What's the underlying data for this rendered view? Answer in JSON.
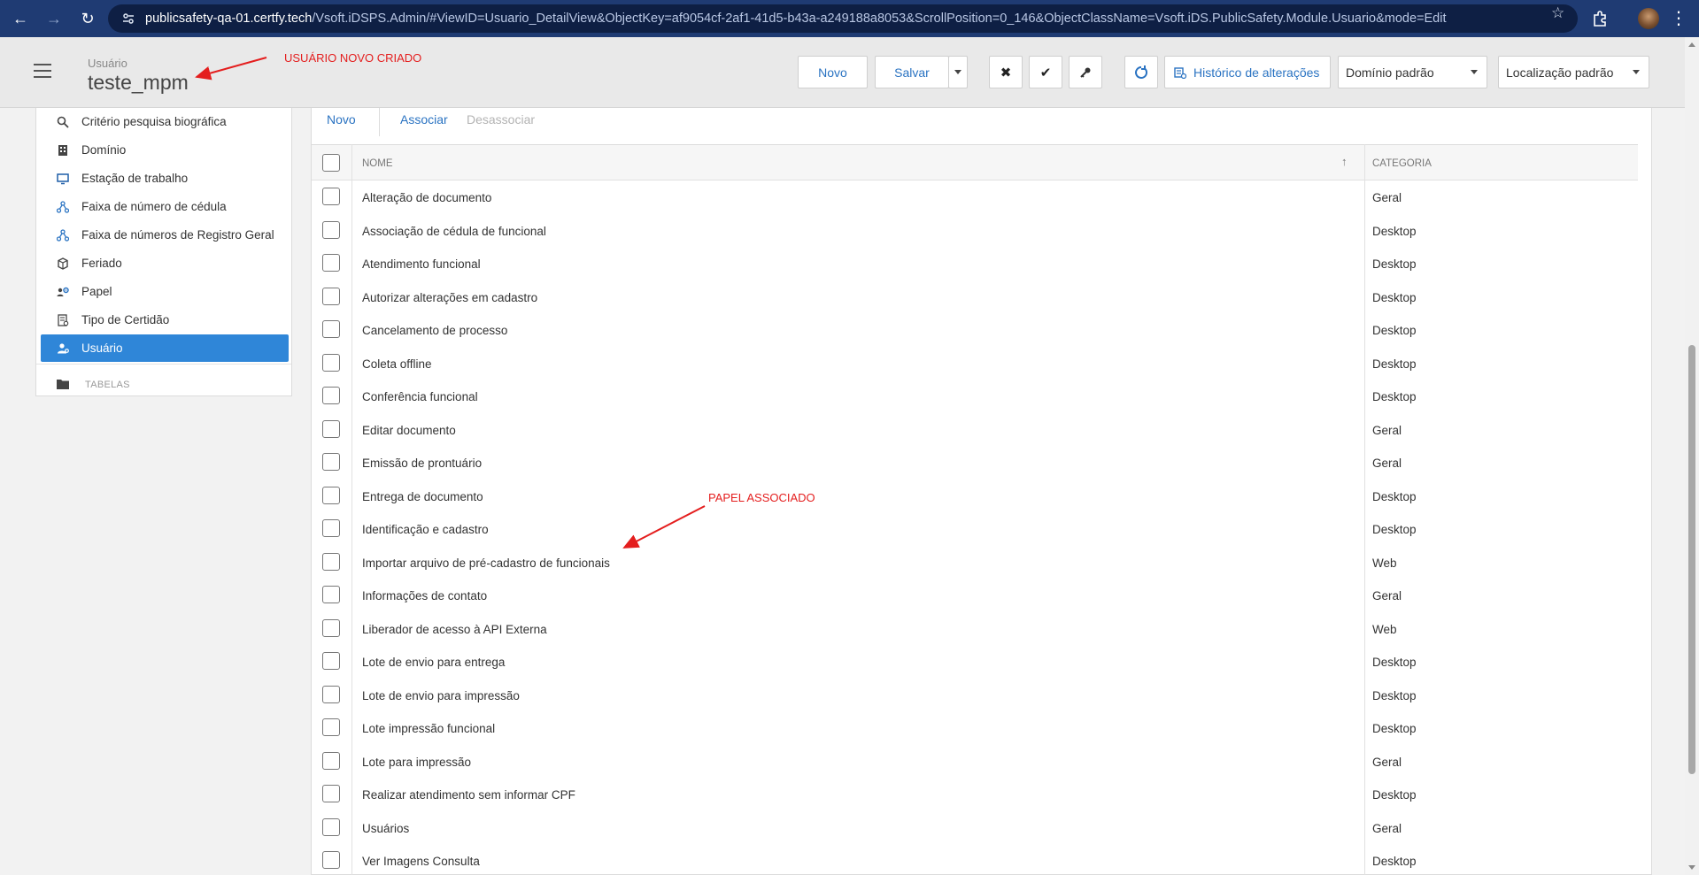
{
  "browser": {
    "url_host": "publicsafety-qa-01.certfy.tech",
    "url_rest": "/Vsoft.iDSPS.Admin/#ViewID=Usuario_DetailView&ObjectKey=af9054cf-2af1-41d5-b43a-a249188a8053&ScrollPosition=0_146&ObjectClassName=Vsoft.iDS.PublicSafety.Module.Usuario&mode=Edit"
  },
  "header": {
    "subtitle": "Usuário",
    "title": "teste_mpm",
    "buttons": {
      "novo": "Novo",
      "salvar": "Salvar",
      "historico": "Histórico de alterações"
    },
    "dominio": "Domínio padrão",
    "localizacao": "Localização padrão"
  },
  "annotations": {
    "user_created": "USUÁRIO NOVO CRIADO",
    "role_associated": "PAPEL ASSOCIADO"
  },
  "sidebar": {
    "items": [
      {
        "label": "Critério pesquisa biográfica",
        "icon": "search-icon"
      },
      {
        "label": "Domínio",
        "icon": "building-icon"
      },
      {
        "label": "Estação de trabalho",
        "icon": "monitor-icon"
      },
      {
        "label": "Faixa de número de cédula",
        "icon": "network-icon"
      },
      {
        "label": "Faixa de números de Registro Geral",
        "icon": "network-icon"
      },
      {
        "label": "Feriado",
        "icon": "box-icon"
      },
      {
        "label": "Papel",
        "icon": "users-gear-icon"
      },
      {
        "label": "Tipo de Certidão",
        "icon": "document-icon"
      },
      {
        "label": "Usuário",
        "icon": "user-icon",
        "active": true
      }
    ],
    "group": "TABELAS"
  },
  "toolbar": {
    "novo": "Novo",
    "associar": "Associar",
    "desassociar": "Desassociar"
  },
  "grid": {
    "columns": {
      "nome": "NOME",
      "categoria": "CATEGORIA"
    },
    "rows": [
      {
        "nome": "Alteração de documento",
        "categoria": "Geral"
      },
      {
        "nome": "Associação de cédula de funcional",
        "categoria": "Desktop"
      },
      {
        "nome": "Atendimento funcional",
        "categoria": "Desktop"
      },
      {
        "nome": "Autorizar alterações em cadastro",
        "categoria": "Desktop"
      },
      {
        "nome": "Cancelamento de processo",
        "categoria": "Desktop"
      },
      {
        "nome": "Coleta offline",
        "categoria": "Desktop"
      },
      {
        "nome": "Conferência funcional",
        "categoria": "Desktop"
      },
      {
        "nome": "Editar documento",
        "categoria": "Geral"
      },
      {
        "nome": "Emissão de prontuário",
        "categoria": "Geral"
      },
      {
        "nome": "Entrega de documento",
        "categoria": "Desktop"
      },
      {
        "nome": "Identificação e cadastro",
        "categoria": "Desktop"
      },
      {
        "nome": "Importar arquivo de pré-cadastro de funcionais",
        "categoria": "Web"
      },
      {
        "nome": "Informações de contato",
        "categoria": "Geral"
      },
      {
        "nome": "Liberador de acesso à API Externa",
        "categoria": "Web"
      },
      {
        "nome": "Lote de envio para entrega",
        "categoria": "Desktop"
      },
      {
        "nome": "Lote de envio para impressão",
        "categoria": "Desktop"
      },
      {
        "nome": "Lote impressão funcional",
        "categoria": "Desktop"
      },
      {
        "nome": "Lote para impressão",
        "categoria": "Geral"
      },
      {
        "nome": "Realizar atendimento sem informar CPF",
        "categoria": "Desktop"
      },
      {
        "nome": "Usuários",
        "categoria": "Geral"
      },
      {
        "nome": "Ver Imagens Consulta",
        "categoria": "Desktop"
      }
    ]
  },
  "colors": {
    "accent": "#2f86d8",
    "link": "#2a73c2",
    "annotation": "#e41e1e",
    "browser_bar": "#1f3b73"
  }
}
